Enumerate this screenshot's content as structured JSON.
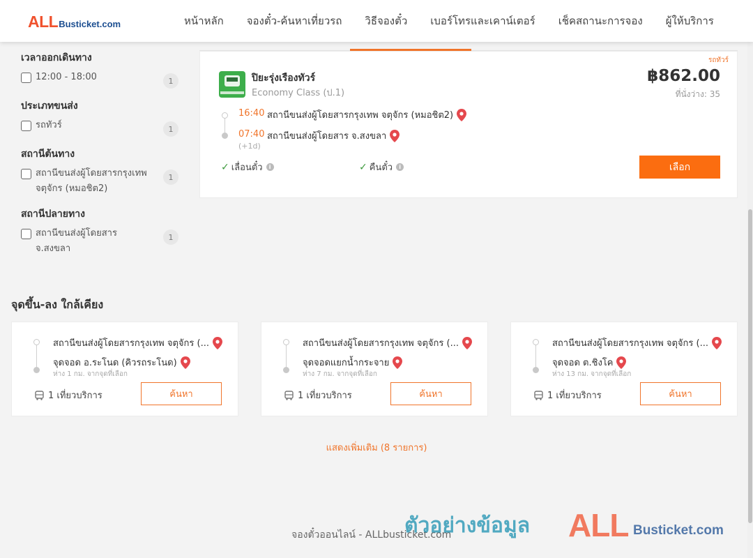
{
  "header": {
    "logo_all": "ALL",
    "logo_rest": "Busticket.com",
    "nav": [
      "หน้าหลัก",
      "จองตั๋ว-ค้นหาเที่ยวรถ",
      "วิธีจองตั๋ว",
      "เบอร์โทรและเคาน์เตอร์",
      "เช็คสถานะการจอง",
      "ผู้ให้บริการ"
    ]
  },
  "filters": {
    "departure_time": {
      "title": "เวลาออกเดินทาง",
      "options": [
        {
          "label": "12:00 - 18:00",
          "count": "1"
        }
      ]
    },
    "transport_type": {
      "title": "ประเภทขนส่ง",
      "options": [
        {
          "label": "รถทัวร์",
          "count": "1"
        }
      ]
    },
    "origin": {
      "title": "สถานีต้นทาง",
      "options": [
        {
          "label": "สถานีขนส่งผู้โดยสารกรุงเทพ จตุจักร (หมอชิต2)",
          "count": "1"
        }
      ]
    },
    "destination": {
      "title": "สถานีปลายทาง",
      "options": [
        {
          "label": "สถานีขนส่งผู้โดยสาร จ.สงขลา",
          "count": "1"
        }
      ]
    }
  },
  "trip": {
    "tag": "รถทัวร์",
    "operator": "ปิยะรุ่งเรืองทัวร์",
    "bus_class": "Economy Class (ป.1)",
    "price": "฿862.00",
    "seats": "ที่นั่งว่าง: 35",
    "depart_time": "16:40",
    "depart_station": "สถานีขนส่งผู้โดยสารกรุงเทพ จตุจักร (หมอชิต2)",
    "arrive_time": "07:40",
    "arrive_station": "สถานีขนส่งผู้โดยสาร จ.สงขลา",
    "day_offset": "(+1d)",
    "feature_1": "เลื่อนตั๋ว",
    "feature_2": "คืนตั๋ว",
    "select_label": "เลือก"
  },
  "nearby": {
    "title": "จุดขึ้น-ลง ใกล้เคียง",
    "cards": [
      {
        "from": "สถานีขนส่งผู้โดยสารกรุงเทพ จตุจักร (...",
        "to": "จุดจอด อ.ระโนด (คิวรถระโนด)",
        "distance": "ห่าง 1 กม. จากจุดที่เลือก",
        "trips": "1 เที่ยวบริการ",
        "button": "ค้นหา"
      },
      {
        "from": "สถานีขนส่งผู้โดยสารกรุงเทพ จตุจักร (...",
        "to": "จุดจอดแยกน้ำกระจาย",
        "distance": "ห่าง 7 กม. จากจุดที่เลือก",
        "trips": "1 เที่ยวบริการ",
        "button": "ค้นหา"
      },
      {
        "from": "สถานีขนส่งผู้โดยสารกรุงเทพ จตุจักร (...",
        "to": "จุดจอด ต.ชิงโค",
        "distance": "ห่าง 13 กม. จากจุดที่เลือก",
        "trips": "1 เที่ยวบริการ",
        "button": "ค้นหา"
      }
    ],
    "show_more": "แสดงเพิ่มเติม (8 รายการ)"
  },
  "footer": {
    "text": "จองตั๋วออนไลน์ - ALLbusticket.com"
  },
  "watermark": {
    "text": "ตัวอย่างข้อมูล",
    "logo_all": "ALL",
    "logo_rest": "Busticket.com"
  },
  "colors": {
    "accent": "#f0742a",
    "button": "#fb6d10",
    "logo_red": "#f0522e",
    "logo_blue": "#1d4f91",
    "check": "#3c9a3c"
  }
}
